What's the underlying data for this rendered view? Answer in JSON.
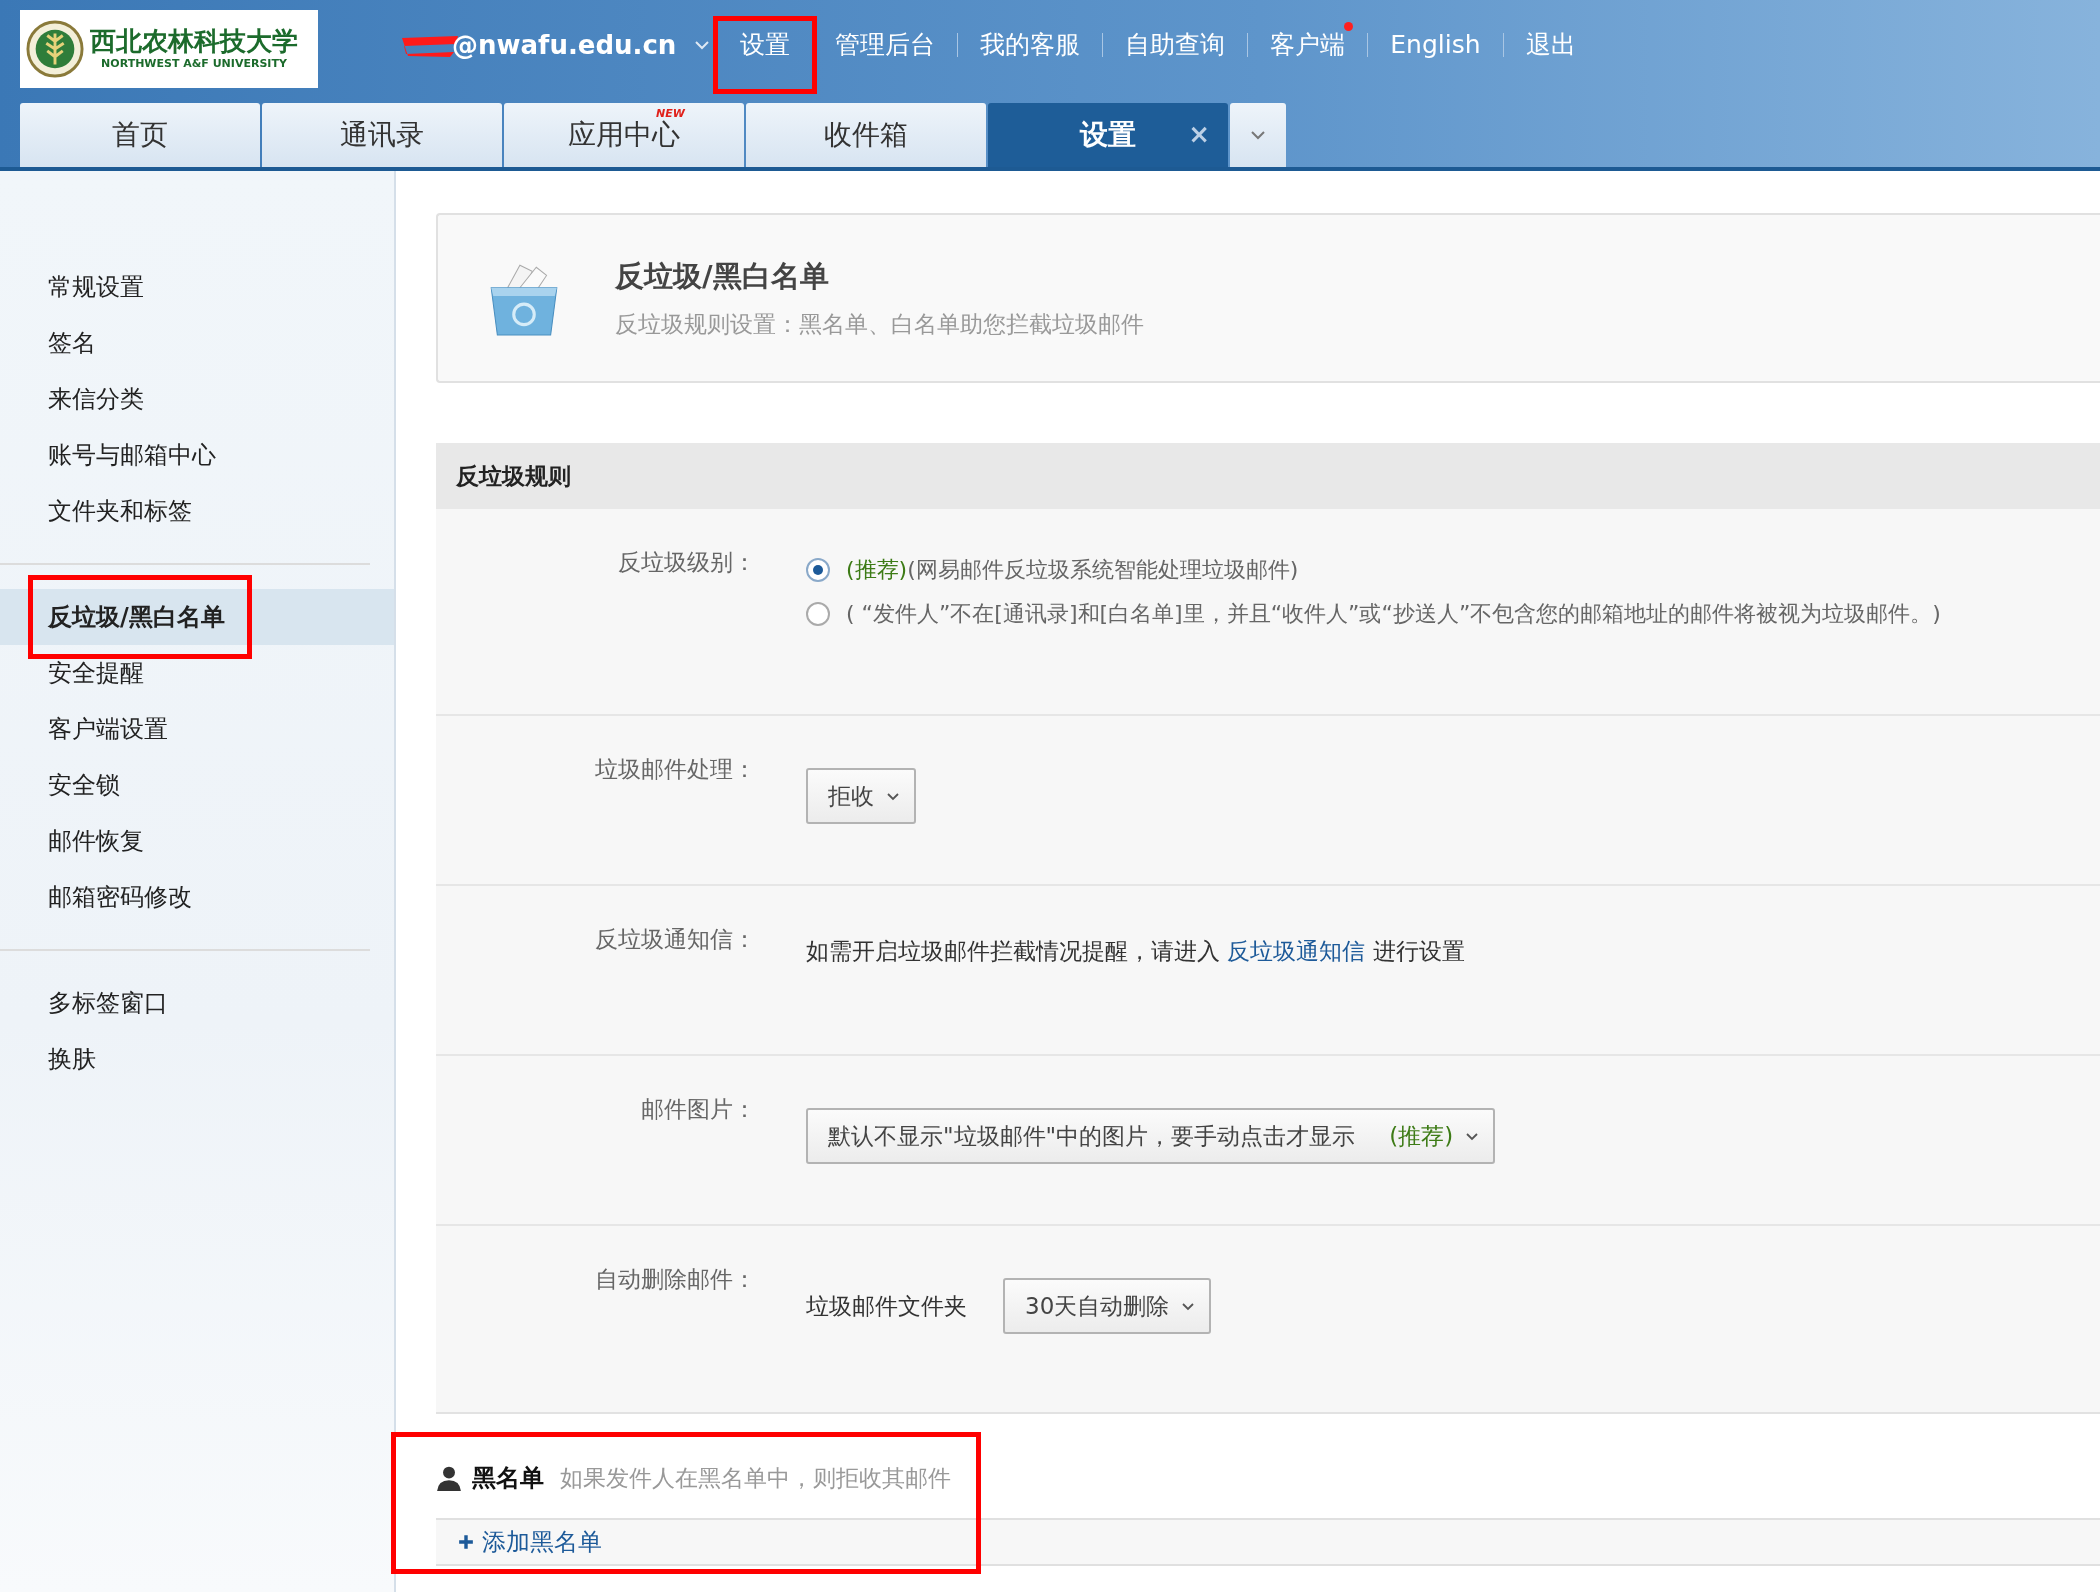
{
  "top_bar": {
    "logo": {
      "name_cn": "西北农林科技大学",
      "name_en": "NORTHWEST A&F UNIVERSITY"
    },
    "account": {
      "email": "@nwafu.edu.cn",
      "redacted": true
    },
    "nav": [
      {
        "label": "设置",
        "highlighted": true
      },
      {
        "label": "管理后台"
      },
      {
        "label": "我的客服"
      },
      {
        "label": "自助查询"
      },
      {
        "label": "客户端",
        "notification_dot": true
      },
      {
        "label": "English"
      },
      {
        "label": "退出"
      }
    ]
  },
  "tabs": [
    {
      "label": "首页",
      "selected": false
    },
    {
      "label": "通讯录",
      "selected": false
    },
    {
      "label": "应用中心",
      "selected": false,
      "badge": "NEW"
    },
    {
      "label": "收件箱",
      "selected": false
    },
    {
      "label": "设置",
      "selected": true,
      "close": "×"
    }
  ],
  "sidebar": {
    "groups": [
      [
        {
          "label": "常规设置",
          "selected": false,
          "highlighted": false
        },
        {
          "label": "签名",
          "selected": false,
          "highlighted": false
        },
        {
          "label": "来信分类",
          "selected": false,
          "highlighted": false
        },
        {
          "label": "账号与邮箱中心",
          "selected": false,
          "highlighted": false
        },
        {
          "label": "文件夹和标签",
          "selected": false,
          "highlighted": false
        }
      ],
      [
        {
          "label": "反垃圾/黑白名单",
          "selected": true,
          "highlighted": true
        },
        {
          "label": "安全提醒",
          "selected": false,
          "highlighted": false
        },
        {
          "label": "客户端设置",
          "selected": false,
          "highlighted": false
        },
        {
          "label": "安全锁",
          "selected": false,
          "highlighted": false
        },
        {
          "label": "邮件恢复",
          "selected": false,
          "highlighted": false
        },
        {
          "label": "邮箱密码修改",
          "selected": false,
          "highlighted": false
        }
      ],
      [
        {
          "label": "多标签窗口",
          "selected": false,
          "highlighted": false
        },
        {
          "label": "换肤",
          "selected": false,
          "highlighted": false
        }
      ]
    ]
  },
  "page_header": {
    "title": "反垃圾/黑白名单",
    "subtitle": "反垃圾规则设置：黑名单、白名单助您拦截垃圾邮件"
  },
  "rules": {
    "title": "反垃圾规则",
    "rows": [
      {
        "kind": "radio",
        "label": "反垃圾级别：",
        "options": [
          {
            "tag": "(推荐)",
            "text": "(网易邮件反垃圾系统智能处理垃圾邮件)",
            "selected": true
          },
          {
            "text": "( “发件人”不在[通讯录]和[白名单]里，并且“收件人”或“抄送人”不包含您的邮箱地址的邮件将被视为垃圾邮件。)",
            "selected": false
          }
        ]
      },
      {
        "kind": "select",
        "label": "垃圾邮件处理：",
        "value": "拒收"
      },
      {
        "kind": "link_text",
        "label": "反垃圾通知信：",
        "before": "如需开启垃圾邮件拦截情况提醒，请进入",
        "link": "反垃圾通知信",
        "after": "进行设置"
      },
      {
        "kind": "select",
        "label": "邮件图片：",
        "value": "默认不显示\"垃圾邮件\"中的图片，要手动点击才显示",
        "tag": "(推荐)"
      },
      {
        "kind": "select",
        "label": "自动删除邮件：",
        "prefix": "垃圾邮件文件夹",
        "value": "30天自动删除"
      }
    ]
  },
  "blacklist": {
    "title": "黑名单",
    "hint": "如果发件人在黑名单中，则拒收其邮件",
    "add": "添加黑名单",
    "highlighted": true
  }
}
